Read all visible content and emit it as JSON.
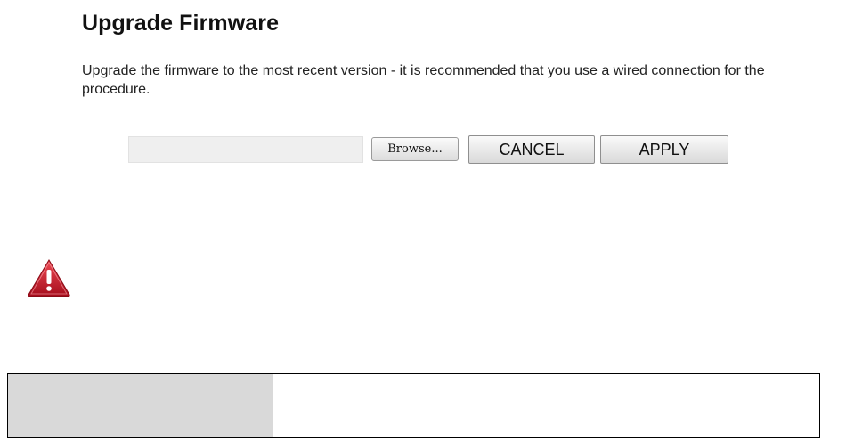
{
  "page": {
    "title": "Upgrade Firmware",
    "description": "Upgrade the firmware to the most recent version - it is recommended that you use a wired connection for the procedure."
  },
  "form": {
    "file_path_value": "",
    "browse_label": "Browse...",
    "cancel_label": "CANCEL",
    "apply_label": "APPLY"
  },
  "warning": {
    "icon": "warning-triangle-icon",
    "colors": {
      "fill": "#c8102e",
      "mark": "#ffffff"
    }
  },
  "info_table": {
    "label_cell": "",
    "value_cell": "",
    "label_background": "#d9d9d9"
  }
}
